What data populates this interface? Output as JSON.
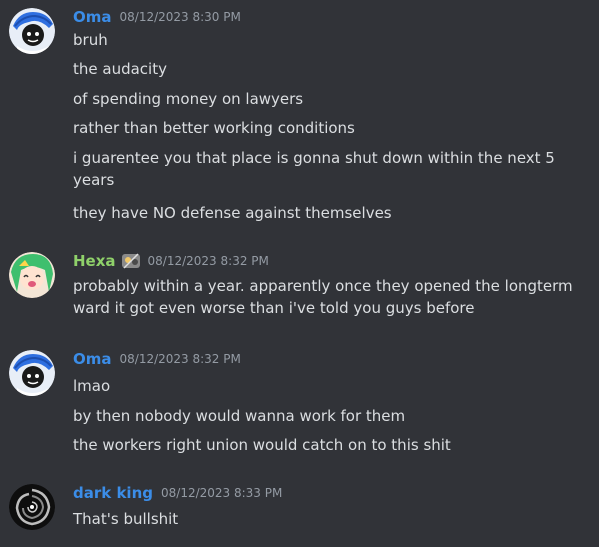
{
  "messages": [
    {
      "username": "Oma",
      "timestamp": "08/12/2023 8:30 PM",
      "lines": [
        "bruh",
        "the audacity",
        "of spending money on lawyers",
        "rather than better working conditions",
        "i guarentee you that place is gonna shut down within the next 5 years",
        "they have NO defense against themselves"
      ]
    },
    {
      "username": "Hexa",
      "timestamp": "08/12/2023 8:32 PM",
      "lines": [
        "probably within a year. apparently once they opened the longterm ward it got even worse than i've told you guys before"
      ]
    },
    {
      "username": "Oma",
      "timestamp": "08/12/2023 8:32 PM",
      "lines": [
        "lmao",
        "by then nobody would wanna work for them",
        "the workers right union would catch on to this shit"
      ]
    },
    {
      "username": "dark king",
      "timestamp": "08/12/2023 8:33 PM",
      "lines": [
        "That's bullshit"
      ]
    }
  ],
  "colors": {
    "background": "#313338",
    "text": "#dbdee1",
    "timestamp": "#949ba4",
    "oma_name": "#3b8de8",
    "hexa_name": "#8fd16a",
    "darkking_name": "#3b8de8"
  }
}
